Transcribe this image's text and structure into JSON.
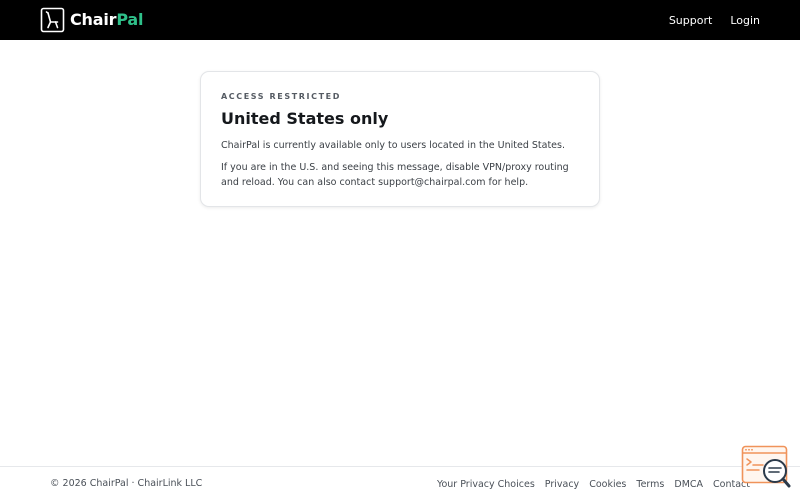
{
  "header": {
    "brand_part1": "Chair",
    "brand_part2": "Pal",
    "nav": [
      "Support",
      "Login"
    ]
  },
  "card": {
    "eyebrow": "ACCESS RESTRICTED",
    "title": "United States only",
    "paragraph1": "ChairPal is currently available only to users located in the United States.",
    "paragraph2": "If you are in the U.S. and seeing this message, disable VPN/proxy routing and reload. You can also contact support@chairpal.com for help."
  },
  "footer": {
    "copyright": "© 2026 ChairPal · ChairLink LLC",
    "links": [
      "Your Privacy Choices",
      "Privacy",
      "Cookies",
      "Terms",
      "DMCA",
      "Contact"
    ]
  },
  "colors": {
    "header_bg": "#000000",
    "brand_accent": "#2fc08a",
    "floater_accent": "#f0935a"
  },
  "icons": {
    "logo": "chair-icon",
    "floater": "search-chat-icon"
  }
}
